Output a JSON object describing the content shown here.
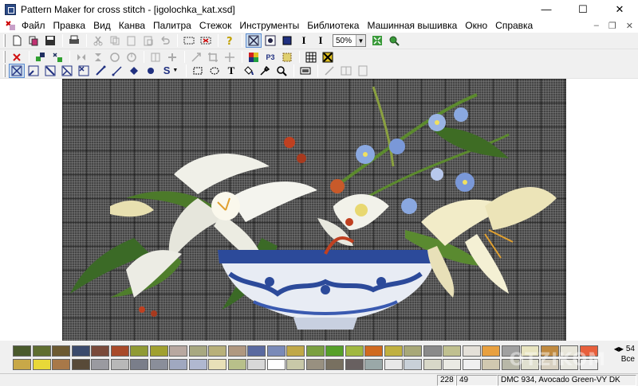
{
  "window": {
    "title": "Pattern Maker for cross stitch - [igolochka_kat.xsd]",
    "minimize": "—",
    "maximize": "☐",
    "close": "✕"
  },
  "menu": {
    "items": [
      "Файл",
      "Правка",
      "Вид",
      "Канва",
      "Палитра",
      "Стежок",
      "Инструменты",
      "Библиотека",
      "Машинная вышивка",
      "Окно",
      "Справка"
    ],
    "mdi_minimize": "–",
    "mdi_restore": "❐",
    "mdi_close": "✕"
  },
  "toolbar": {
    "zoom_value": "50%",
    "italic_label": "I",
    "font_label": "I",
    "text_tool_label": "T",
    "stitch_s_label": "S",
    "p3_label": "P3"
  },
  "palette": {
    "row1": [
      "#4a5a2c",
      "#5f6e30",
      "#6c5a32",
      "#3a4a6c",
      "#7a4a3a",
      "#a84a2a",
      "#909a34",
      "#a0a030",
      "#b8a8a0",
      "#a8a880",
      "#b8b07a",
      "#b09880",
      "#5a6aa0",
      "#7a8ab8",
      "#c0a848",
      "#7aa040",
      "#56a02a",
      "#a0b840",
      "#d06a20",
      "#c0b040",
      "#a8a878",
      "#8a8a8a",
      "#c0c090",
      "#e4e0d8",
      "#e8a040",
      "#a0a0a0",
      "#e8e4c0",
      "#c08a40",
      "#e8e6da",
      "#e8603c"
    ],
    "row2": [
      "#c8a848",
      "#e8d838",
      "#a87848",
      "#584a38",
      "#9a9aa0",
      "#b8b8b8",
      "#7a7e8a",
      "#8a8e9a",
      "#a0a8c0",
      "#b0b8d0",
      "#e8e0b8",
      "#b8c08a",
      "#d8d8d8",
      "#ffffff",
      "#c8c8a8",
      "#989080",
      "#787060",
      "#686060",
      "#9aa8a8",
      "#e8e8e8",
      "#c8d0d8",
      "#d8d8c8",
      "#eaeae4",
      "#f0f0f0",
      "#d0c8b0",
      "#b8b8a8",
      "#e0e0d0",
      "#d8d0c0",
      "#e8e8e0",
      "#ececec"
    ],
    "count": "54",
    "all_label": "Все",
    "watermark": "OTZIKOM"
  },
  "status": {
    "x": "228",
    "y": "49",
    "thread": "DMC  934, Avocado Green-VY DK"
  }
}
